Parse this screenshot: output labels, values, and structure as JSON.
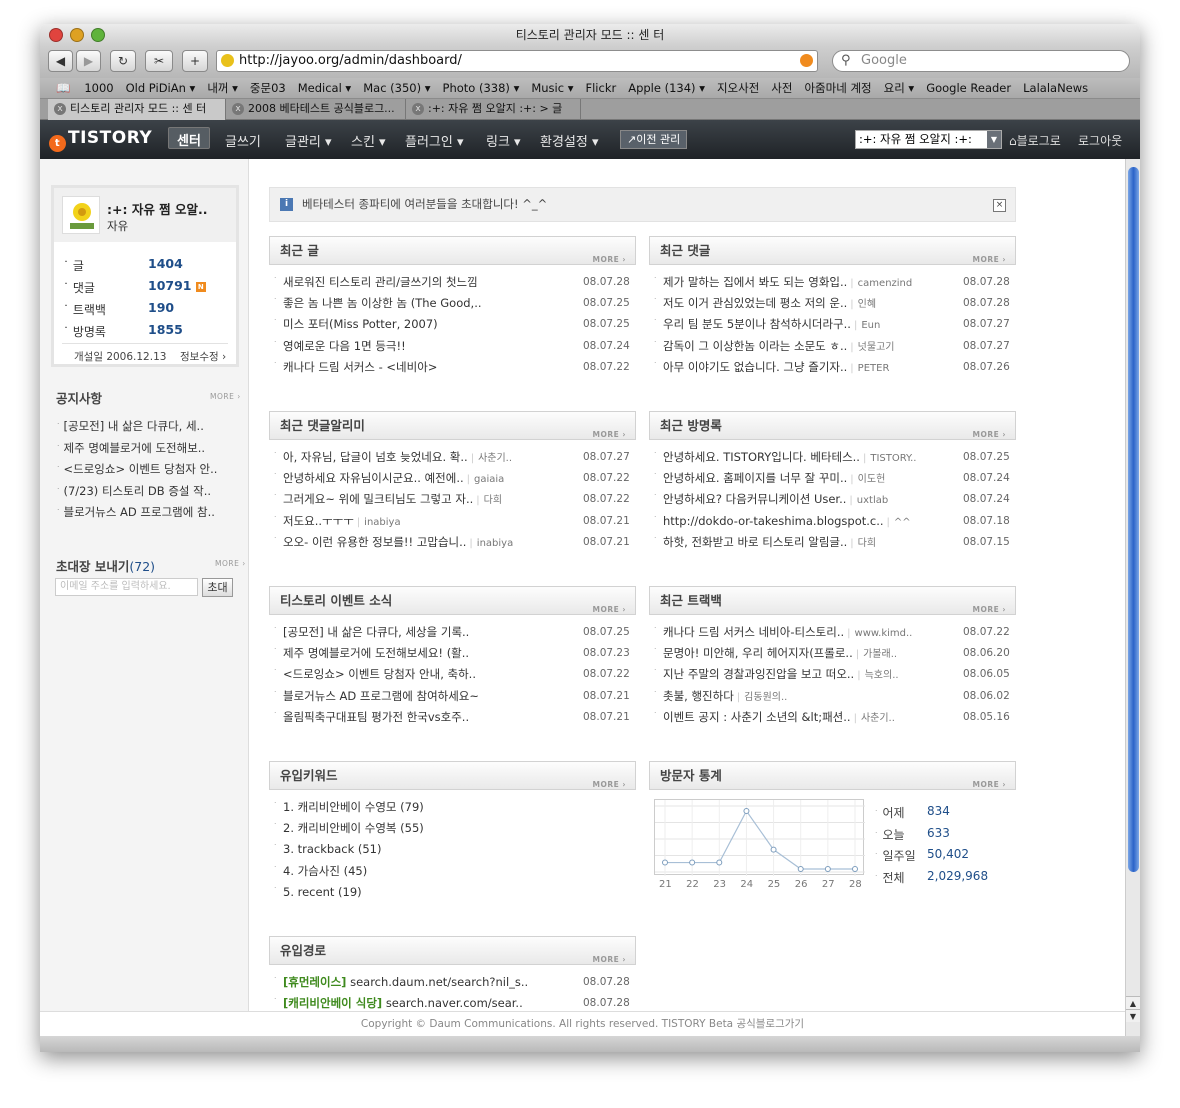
{
  "window": {
    "title": "티스토리 관리자 모드 :: 센 터"
  },
  "toolbar": {
    "url": "http://jayoo.org/admin/dashboard/",
    "search_placeholder": "Google"
  },
  "bookmarks": [
    "1000",
    "Old PiDiAn ▾",
    "내꺼 ▾",
    "중문03",
    "Medical ▾",
    "Mac (350) ▾",
    "Photo (338) ▾",
    "Music ▾",
    "Flickr",
    "Apple (134) ▾",
    "지오사전",
    "사전",
    "아줌마네 계정",
    "요리 ▾",
    "Google Reader",
    "LalalaNews"
  ],
  "tabs": [
    "티스토리 관리자 모드 :: 센 터",
    "2008 베타테스트 공식블로그...",
    ":+: 자유 쩜 오알지 :+: > 글"
  ],
  "nav": {
    "logo": "TISTORY",
    "items": [
      "센터",
      "글쓰기",
      "글관리 ▾",
      "스킨 ▾",
      "플러그인 ▾",
      "링크 ▾",
      "환경설정 ▾"
    ],
    "old_admin": "↗이전 관리",
    "blog_select": ":+: 자유 쩜 오알지 :+:",
    "blog_link": "블로그로",
    "logout": "로그아웃"
  },
  "profile": {
    "name": ":+: 자유 쩜 오알..",
    "owner": "자유",
    "stats": [
      {
        "label": "글",
        "value": "1404"
      },
      {
        "label": "댓글",
        "value": "10791"
      },
      {
        "label": "트랙백",
        "value": "190"
      },
      {
        "label": "방명록",
        "value": "1855"
      }
    ],
    "opened": "개설일 2006.12.13",
    "edit": "정보수정 ›"
  },
  "sidebar": {
    "notice_title": "공지사항",
    "more": "MORE ›",
    "notices": [
      "[공모전] 내 삶은 다큐다, 세..",
      "제주 명예블로거에 도전해보..",
      "<드로잉쇼> 이벤트 당첨자 안..",
      "(7/23) 티스토리 DB 증설 작..",
      "블로거뉴스 AD 프로그램에 참.."
    ],
    "invite_title": "초대장 보내기",
    "invite_count": "(72)",
    "invite_placeholder": "이메일 주소를 입력하세요.",
    "invite_button": "초대"
  },
  "notice_bar": {
    "text": "베타테스터 종파티에 여러분들을 초대합니다! ^_^",
    "close": "×"
  },
  "panels": {
    "recent_posts": {
      "title": "최근 글",
      "rows": [
        {
          "t": "새로워진 티스토리 관리/글쓰기의 첫느낌",
          "d": "08.07.28"
        },
        {
          "t": "좋은 놈 나쁜 놈 이상한 놈 (The Good,..",
          "d": "08.07.25"
        },
        {
          "t": "미스 포터(Miss Potter, 2007)",
          "d": "08.07.25"
        },
        {
          "t": "영예로운 다음 1면 등극!!",
          "d": "08.07.24"
        },
        {
          "t": "캐나다 드림 서커스 - <네비아>",
          "d": "08.07.22"
        }
      ]
    },
    "recent_comments": {
      "title": "최근 댓글",
      "rows": [
        {
          "t": "제가 말하는 집에서 봐도 되는 영화입..",
          "a": "camenzind",
          "d": "08.07.28"
        },
        {
          "t": "저도 이거 관심있었는데 평소 저의 운..",
          "a": "인혜",
          "d": "08.07.28"
        },
        {
          "t": "우리 팀 분도 5분이나 참석하시더라구..",
          "a": "Eun",
          "d": "08.07.27"
        },
        {
          "t": "감독이 그 이상한놈 이라는 소문도 ㅎ..",
          "a": "넛물고기",
          "d": "08.07.27"
        },
        {
          "t": "아무 이야기도 없습니다. 그냥 즐기자..",
          "a": "PETER",
          "d": "08.07.26"
        }
      ]
    },
    "comment_alarm": {
      "title": "최근 댓글알리미",
      "rows": [
        {
          "t": "아, 자유님, 답글이 넘호 늦었네요. 확..",
          "a": "사춘기..",
          "d": "08.07.27"
        },
        {
          "t": "안녕하세요 자유님이시군요.. 예전에..",
          "a": "gaiaia",
          "d": "08.07.22"
        },
        {
          "t": "그러게요~ 위에 밀크티님도 그렇고 자..",
          "a": "다희",
          "d": "08.07.22"
        },
        {
          "t": "저도요..ㅜㅜㅜ",
          "a": "inabiya",
          "d": "08.07.21"
        },
        {
          "t": "오오- 이런 유용한 정보를!! 고맙습니..",
          "a": "inabiya",
          "d": "08.07.21"
        }
      ]
    },
    "guestbook": {
      "title": "최근 방명록",
      "rows": [
        {
          "t": "안녕하세요. TISTORY입니다. 베타테스..",
          "a": "TISTORY..",
          "d": "08.07.25"
        },
        {
          "t": "안녕하세요. 홈페이지를 너무 잘 꾸미..",
          "a": "이도헌",
          "d": "08.07.24"
        },
        {
          "t": "안녕하세요? 다음커뮤니케이션 User..",
          "a": "uxtlab",
          "d": "08.07.24"
        },
        {
          "t": "http://dokdo-or-takeshima.blogspot.c..",
          "a": "^^",
          "d": "08.07.18"
        },
        {
          "t": "하핫, 전화받고 바로 티스토리 알림글..",
          "a": "다희",
          "d": "08.07.15"
        }
      ]
    },
    "events": {
      "title": "티스토리 이벤트 소식",
      "rows": [
        {
          "t": "[공모전] 내 삶은 다큐다, 세상을 기록..",
          "d": "08.07.25"
        },
        {
          "t": "제주 명예블로거에 도전해보세요! (활..",
          "d": "08.07.23"
        },
        {
          "t": "<드로잉쇼> 이벤트 당첨자 안내, 축하..",
          "d": "08.07.22"
        },
        {
          "t": "블로거뉴스 AD 프로그램에 참여하세요~",
          "d": "08.07.21"
        },
        {
          "t": "올림픽축구대표팀 평가전 한국vs호주..",
          "d": "08.07.21"
        }
      ]
    },
    "trackbacks": {
      "title": "최근 트랙백",
      "rows": [
        {
          "t": "캐나다 드림 서커스 네비아-티스토리..",
          "a": "www.kimd..",
          "d": "08.07.22"
        },
        {
          "t": "문명아! 미안해, 우리 헤어지자(프롤로..",
          "a": "가볼래..",
          "d": "08.06.20"
        },
        {
          "t": "지난 주말의 경찰과잉진압을 보고 떠오..",
          "a": "늑호의..",
          "d": "08.06.05"
        },
        {
          "t": "촛불, 행진하다",
          "a": "김동원의..",
          "d": "08.06.02"
        },
        {
          "t": "이벤트 공지 : 사춘기 소년의 &lt;패션..",
          "a": "사춘기..",
          "d": "08.05.16"
        }
      ]
    },
    "keywords": {
      "title": "유입키워드",
      "rows": [
        "1. 캐리비안베이 수영모 (79)",
        "2. 캐리비안베이 수영복 (55)",
        "3. trackback (51)",
        "4. 가슴사진 (45)",
        "5. recent (19)"
      ]
    },
    "visitors": {
      "title": "방문자 통계",
      "stats": [
        {
          "label": "어제",
          "value": "834"
        },
        {
          "label": "오늘",
          "value": "633"
        },
        {
          "label": "일주일",
          "value": "50,402"
        },
        {
          "label": "전체",
          "value": "2,029,968"
        }
      ]
    },
    "referrers": {
      "title": "유입경로",
      "rows": [
        {
          "k": "[휴먼레이스]",
          "t": "search.daum.net/search?nil_s..",
          "d": "08.07.28"
        },
        {
          "k": "[캐리비안베이 식당]",
          "t": "search.naver.com/sear..",
          "d": "08.07.28"
        }
      ]
    }
  },
  "chart_data": {
    "type": "line",
    "categories": [
      "21",
      "22",
      "23",
      "24",
      "25",
      "26",
      "27",
      "28"
    ],
    "values": [
      1,
      1,
      1,
      9,
      3,
      0,
      0,
      0
    ],
    "xlabel": "",
    "ylabel": "",
    "grid": true
  },
  "footer": {
    "text": "Copyright © Daum Communications. All rights reserved. TISTORY Beta 공식블로그가기"
  }
}
